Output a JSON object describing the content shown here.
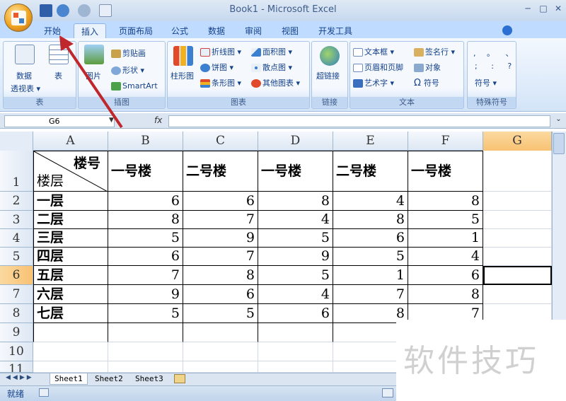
{
  "window": {
    "title": "Book1 - Microsoft Excel",
    "min": "─",
    "max": "□",
    "close": "✕"
  },
  "tabs": [
    "开始",
    "插入",
    "页面布局",
    "公式",
    "数据",
    "审阅",
    "视图",
    "开发工具"
  ],
  "active_tab": "插入",
  "ribbon": {
    "tables": {
      "label": "表",
      "pivot_line1": "数据",
      "pivot_line2": "透视表 ▾",
      "table": "表"
    },
    "illustrations": {
      "label": "插图",
      "picture": "图片",
      "clipart": "剪贴画",
      "shapes": "形状 ▾",
      "smartart": "SmartArt"
    },
    "charts": {
      "label": "图表",
      "column": "柱形图",
      "line": "折线图 ▾",
      "pie": "饼图 ▾",
      "bar": "条形图 ▾",
      "area": "面积图 ▾",
      "scatter": "散点图 ▾",
      "other": "其他图表 ▾"
    },
    "links": {
      "label": "链接",
      "hyperlink": "超链接"
    },
    "text": {
      "label": "文本",
      "textbox": "文本框 ▾",
      "header": "页眉和页脚",
      "wordart": "艺术字 ▾",
      "signature": "签名行 ▾",
      "object": "对象",
      "symbol": "符号"
    },
    "special": {
      "label": "特殊符号",
      "row1": ", 。 、",
      "row2": "; : ?",
      "symbol": "符号 ▾"
    }
  },
  "formula": {
    "namebox": "G6",
    "fx": "fx",
    "value": ""
  },
  "columns": [
    "A",
    "B",
    "C",
    "D",
    "E",
    "F",
    "G"
  ],
  "rows": [
    "1",
    "2",
    "3",
    "4",
    "5",
    "6",
    "7",
    "8",
    "9",
    "10",
    "11"
  ],
  "table": {
    "corner_top": "楼号",
    "corner_bottom": "楼层",
    "headers": [
      "一号楼",
      "二号楼",
      "一号楼",
      "二号楼",
      "一号楼"
    ],
    "floors": [
      "一层",
      "二层",
      "三层",
      "四层",
      "五层",
      "六层",
      "七层"
    ],
    "values": [
      [
        6,
        6,
        8,
        4,
        8
      ],
      [
        8,
        7,
        4,
        8,
        5
      ],
      [
        5,
        9,
        5,
        6,
        1
      ],
      [
        6,
        7,
        9,
        5,
        4
      ],
      [
        7,
        8,
        5,
        1,
        6
      ],
      [
        9,
        6,
        4,
        7,
        8
      ],
      [
        5,
        5,
        6,
        8,
        7
      ]
    ]
  },
  "sheets": [
    "Sheet1",
    "Sheet2",
    "Sheet3"
  ],
  "status": {
    "ready": "就绪"
  },
  "watermark": "软件技巧",
  "colors": {
    "arrow": "#c0272d",
    "selected_header": "#f8c272"
  }
}
